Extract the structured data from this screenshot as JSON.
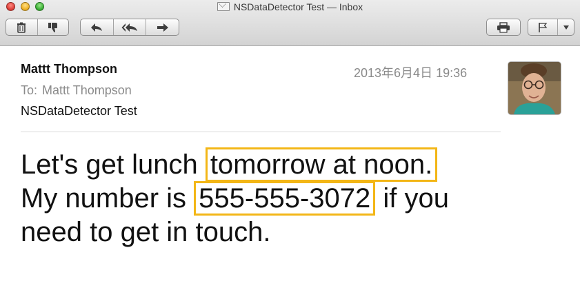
{
  "window": {
    "title": "NSDataDetector Test — Inbox"
  },
  "toolbar": {
    "delete_icon": "trash-icon",
    "junk_icon": "thumbs-down-icon",
    "reply_icon": "reply-arrow-icon",
    "reply_all_icon": "reply-all-arrows-icon",
    "forward_icon": "forward-arrow-icon",
    "print_icon": "printer-icon",
    "flag_icon": "flag-icon",
    "flag_menu_icon": "chevron-down-icon"
  },
  "message": {
    "sender": "Mattt Thompson",
    "to_label": "To:",
    "to_name": "Mattt Thompson",
    "subject": "NSDataDetector Test",
    "date": "2013年6月4日 19:36",
    "body": {
      "line1_prefix": "Let's get lunch ",
      "detected_date": "tomorrow at noon.",
      "line2_prefix": "My number is ",
      "detected_phone": "555-555-3072",
      "line2_suffix": " if you",
      "line3": "need to get in touch."
    }
  },
  "colors": {
    "highlight": "#f3b616",
    "toolbar_top": "#ececec",
    "toolbar_bottom": "#d3d3d3"
  }
}
